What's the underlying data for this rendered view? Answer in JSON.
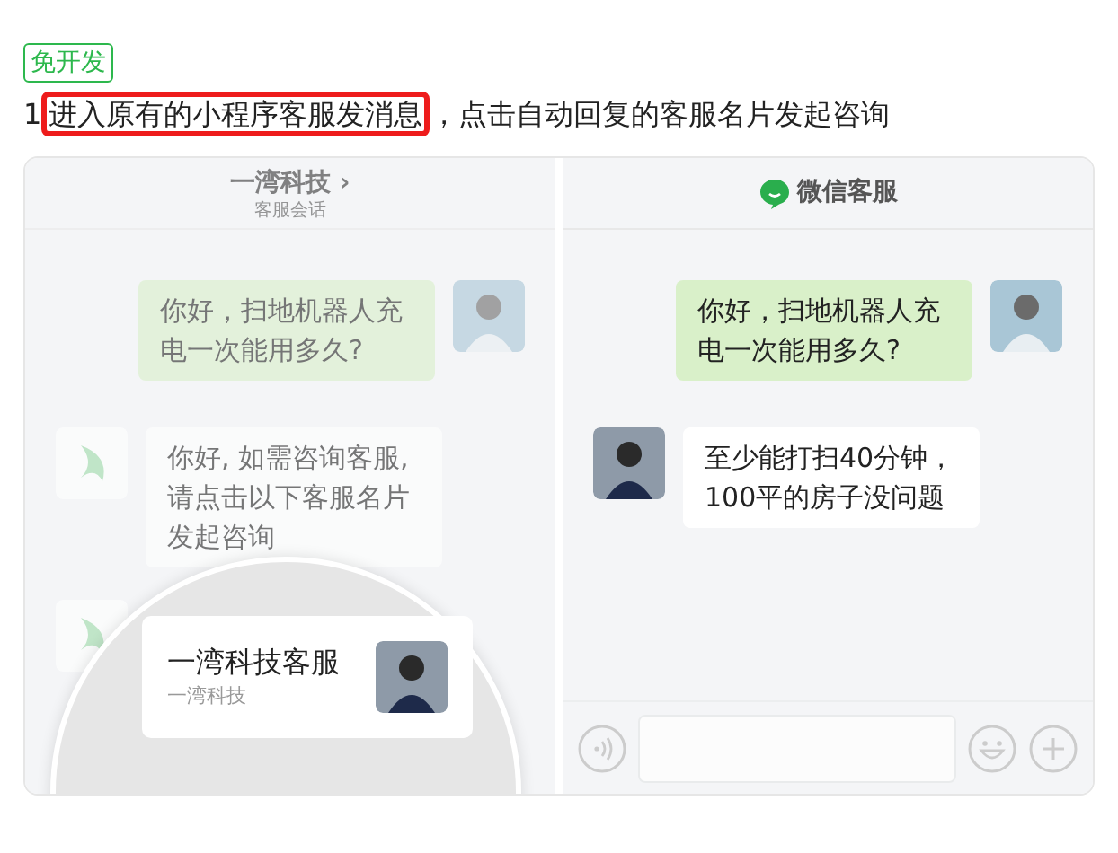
{
  "badge": "免开发",
  "instruction": {
    "number": "1",
    "highlight": "进入原有的小程序客服发消息",
    "rest": "，点击自动回复的客服名片发起咨询"
  },
  "left_pane": {
    "title": "一湾科技",
    "chevron": "›",
    "subtitle": "客服会话",
    "messages": [
      {
        "kind": "user",
        "text": "你好，扫地机器人充电一次能用多久?"
      },
      {
        "kind": "bot",
        "text": "你好, 如需咨询客服, 请点击以下客服名片发起咨询"
      }
    ],
    "card": {
      "name": "一湾科技客服",
      "company": "一湾科技"
    }
  },
  "right_pane": {
    "title": "微信客服",
    "messages": [
      {
        "kind": "user",
        "text": "你好，扫地机器人充电一次能用多久?"
      },
      {
        "kind": "agent",
        "text": "至少能打扫40分钟，100平的房子没问题"
      }
    ]
  }
}
